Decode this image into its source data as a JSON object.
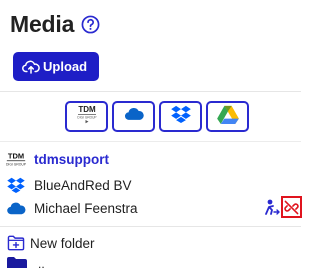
{
  "header": {
    "title": "Media",
    "help_icon": "question-circle-icon"
  },
  "upload": {
    "label": "Upload",
    "icon": "cloud-upload-icon"
  },
  "sources": [
    {
      "name": "tdm",
      "icon": "tdm-logo-icon"
    },
    {
      "name": "onedrive",
      "icon": "onedrive-cloud-icon"
    },
    {
      "name": "dropbox",
      "icon": "dropbox-icon"
    },
    {
      "name": "google-drive",
      "icon": "google-drive-icon"
    }
  ],
  "accounts": [
    {
      "label": "tdmsupport",
      "icon": "tdm-logo-icon"
    },
    {
      "label": "BlueAndRed BV",
      "icon": "dropbox-icon"
    },
    {
      "label": "Michael Feenstra",
      "icon": "onedrive-cloud-icon"
    }
  ],
  "new_folder": {
    "label": "New folder",
    "icon": "folder-plus-icon"
  },
  "folder_item": {
    "label": ".."
  },
  "colors": {
    "accent": "#1e1ec6",
    "danger": "#e0141e",
    "dropbox": "#0061fe",
    "onedrive": "#0a64c8"
  }
}
